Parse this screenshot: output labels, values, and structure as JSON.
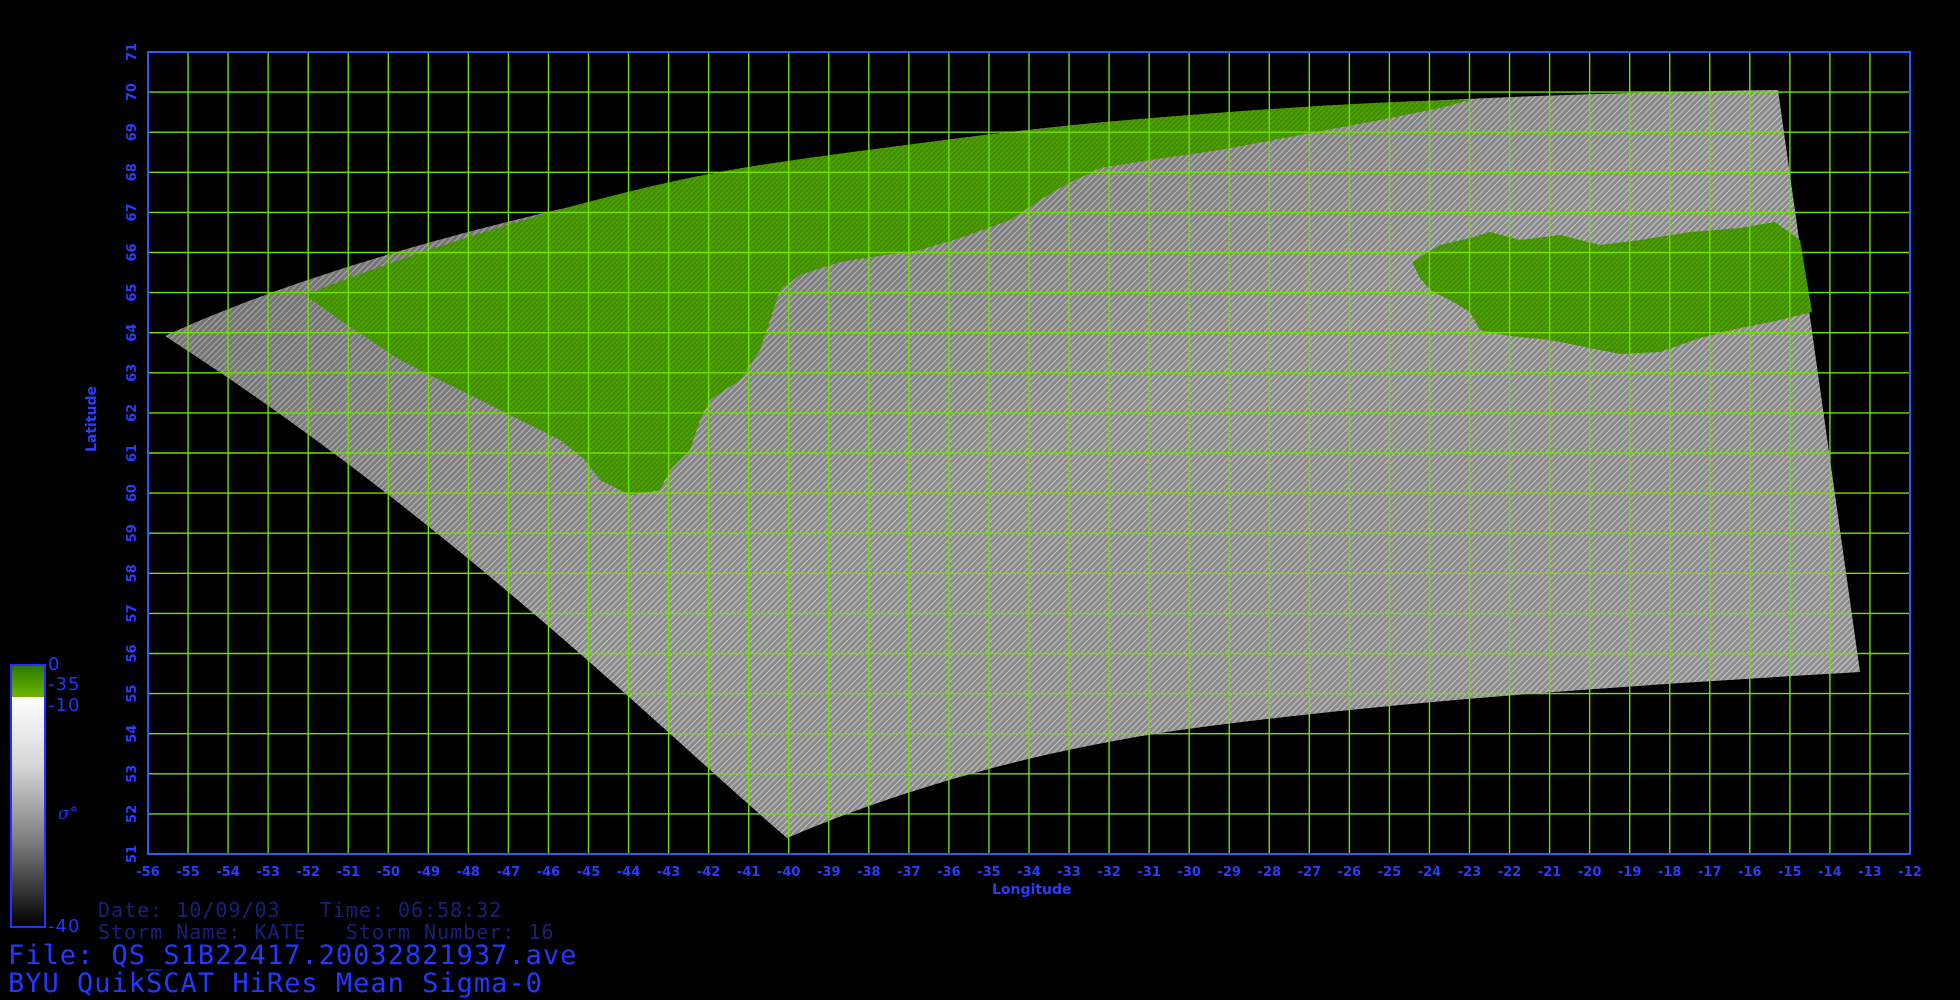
{
  "map": {
    "lon_range": [
      -56,
      -12
    ],
    "lat_range": [
      51,
      71
    ],
    "lon_ticks": [
      -56,
      -55,
      -54,
      -53,
      -52,
      -51,
      -50,
      -49,
      -48,
      -47,
      -46,
      -45,
      -44,
      -43,
      -42,
      -41,
      -40,
      -39,
      -38,
      -37,
      -36,
      -35,
      -34,
      -33,
      -32,
      -31,
      -30,
      -29,
      -28,
      -27,
      -26,
      -25,
      -24,
      -23,
      -22,
      -21,
      -20,
      -19,
      -18,
      -17,
      -16,
      -15,
      -14,
      -13,
      -12
    ],
    "lat_ticks": [
      51,
      52,
      53,
      54,
      55,
      56,
      57,
      58,
      59,
      60,
      61,
      62,
      63,
      64,
      65,
      66,
      67,
      68,
      69,
      70,
      71
    ],
    "xlabel": "Longitude",
    "ylabel": "Latitude",
    "grid": true,
    "colors": {
      "grid": "#6fe000",
      "frame": "#2b5bff",
      "tick_text": "#2a3dff",
      "land": "#3d8a00",
      "ocean": "#9a9a9a"
    }
  },
  "colorbar": {
    "labels": {
      "top": "0",
      "land_sep": "-35",
      "ocean_top": "-10",
      "bottom": "-40"
    },
    "symbol": "σ°"
  },
  "info": {
    "date_line": "Date: 10/09/03   Time: 06:58:32",
    "storm_line": "Storm Name: KATE   Storm Number: 16",
    "file_line": "File: QS_S1B22417.20032821937.ave",
    "title_line": "BYU QuikSCAT HiRes Mean Sigma-0"
  }
}
